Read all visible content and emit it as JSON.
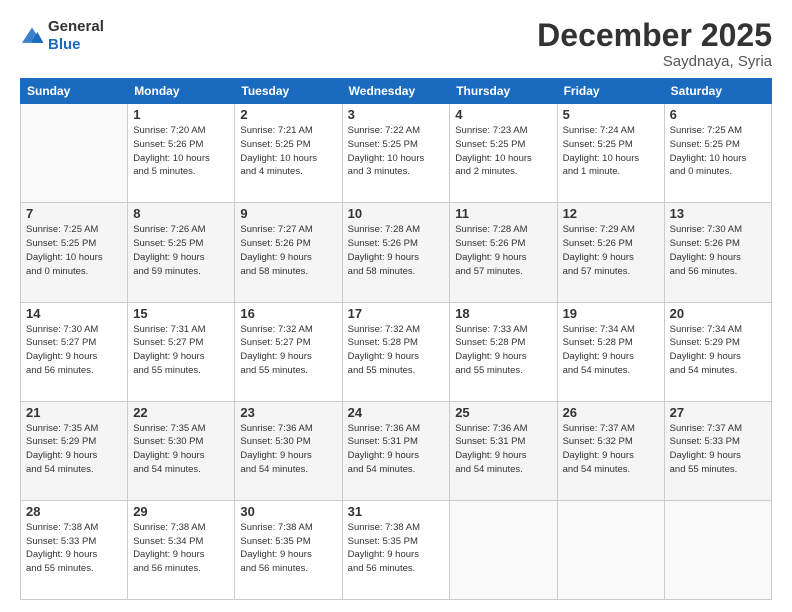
{
  "logo": {
    "general": "General",
    "blue": "Blue"
  },
  "header": {
    "month": "December 2025",
    "location": "Saydnaya, Syria"
  },
  "days_of_week": [
    "Sunday",
    "Monday",
    "Tuesday",
    "Wednesday",
    "Thursday",
    "Friday",
    "Saturday"
  ],
  "weeks": [
    [
      {
        "day": "",
        "info": ""
      },
      {
        "day": "1",
        "info": "Sunrise: 7:20 AM\nSunset: 5:26 PM\nDaylight: 10 hours\nand 5 minutes."
      },
      {
        "day": "2",
        "info": "Sunrise: 7:21 AM\nSunset: 5:25 PM\nDaylight: 10 hours\nand 4 minutes."
      },
      {
        "day": "3",
        "info": "Sunrise: 7:22 AM\nSunset: 5:25 PM\nDaylight: 10 hours\nand 3 minutes."
      },
      {
        "day": "4",
        "info": "Sunrise: 7:23 AM\nSunset: 5:25 PM\nDaylight: 10 hours\nand 2 minutes."
      },
      {
        "day": "5",
        "info": "Sunrise: 7:24 AM\nSunset: 5:25 PM\nDaylight: 10 hours\nand 1 minute."
      },
      {
        "day": "6",
        "info": "Sunrise: 7:25 AM\nSunset: 5:25 PM\nDaylight: 10 hours\nand 0 minutes."
      }
    ],
    [
      {
        "day": "7",
        "info": "Sunrise: 7:25 AM\nSunset: 5:25 PM\nDaylight: 10 hours\nand 0 minutes."
      },
      {
        "day": "8",
        "info": "Sunrise: 7:26 AM\nSunset: 5:25 PM\nDaylight: 9 hours\nand 59 minutes."
      },
      {
        "day": "9",
        "info": "Sunrise: 7:27 AM\nSunset: 5:26 PM\nDaylight: 9 hours\nand 58 minutes."
      },
      {
        "day": "10",
        "info": "Sunrise: 7:28 AM\nSunset: 5:26 PM\nDaylight: 9 hours\nand 58 minutes."
      },
      {
        "day": "11",
        "info": "Sunrise: 7:28 AM\nSunset: 5:26 PM\nDaylight: 9 hours\nand 57 minutes."
      },
      {
        "day": "12",
        "info": "Sunrise: 7:29 AM\nSunset: 5:26 PM\nDaylight: 9 hours\nand 57 minutes."
      },
      {
        "day": "13",
        "info": "Sunrise: 7:30 AM\nSunset: 5:26 PM\nDaylight: 9 hours\nand 56 minutes."
      }
    ],
    [
      {
        "day": "14",
        "info": "Sunrise: 7:30 AM\nSunset: 5:27 PM\nDaylight: 9 hours\nand 56 minutes."
      },
      {
        "day": "15",
        "info": "Sunrise: 7:31 AM\nSunset: 5:27 PM\nDaylight: 9 hours\nand 55 minutes."
      },
      {
        "day": "16",
        "info": "Sunrise: 7:32 AM\nSunset: 5:27 PM\nDaylight: 9 hours\nand 55 minutes."
      },
      {
        "day": "17",
        "info": "Sunrise: 7:32 AM\nSunset: 5:28 PM\nDaylight: 9 hours\nand 55 minutes."
      },
      {
        "day": "18",
        "info": "Sunrise: 7:33 AM\nSunset: 5:28 PM\nDaylight: 9 hours\nand 55 minutes."
      },
      {
        "day": "19",
        "info": "Sunrise: 7:34 AM\nSunset: 5:28 PM\nDaylight: 9 hours\nand 54 minutes."
      },
      {
        "day": "20",
        "info": "Sunrise: 7:34 AM\nSunset: 5:29 PM\nDaylight: 9 hours\nand 54 minutes."
      }
    ],
    [
      {
        "day": "21",
        "info": "Sunrise: 7:35 AM\nSunset: 5:29 PM\nDaylight: 9 hours\nand 54 minutes."
      },
      {
        "day": "22",
        "info": "Sunrise: 7:35 AM\nSunset: 5:30 PM\nDaylight: 9 hours\nand 54 minutes."
      },
      {
        "day": "23",
        "info": "Sunrise: 7:36 AM\nSunset: 5:30 PM\nDaylight: 9 hours\nand 54 minutes."
      },
      {
        "day": "24",
        "info": "Sunrise: 7:36 AM\nSunset: 5:31 PM\nDaylight: 9 hours\nand 54 minutes."
      },
      {
        "day": "25",
        "info": "Sunrise: 7:36 AM\nSunset: 5:31 PM\nDaylight: 9 hours\nand 54 minutes."
      },
      {
        "day": "26",
        "info": "Sunrise: 7:37 AM\nSunset: 5:32 PM\nDaylight: 9 hours\nand 54 minutes."
      },
      {
        "day": "27",
        "info": "Sunrise: 7:37 AM\nSunset: 5:33 PM\nDaylight: 9 hours\nand 55 minutes."
      }
    ],
    [
      {
        "day": "28",
        "info": "Sunrise: 7:38 AM\nSunset: 5:33 PM\nDaylight: 9 hours\nand 55 minutes."
      },
      {
        "day": "29",
        "info": "Sunrise: 7:38 AM\nSunset: 5:34 PM\nDaylight: 9 hours\nand 56 minutes."
      },
      {
        "day": "30",
        "info": "Sunrise: 7:38 AM\nSunset: 5:35 PM\nDaylight: 9 hours\nand 56 minutes."
      },
      {
        "day": "31",
        "info": "Sunrise: 7:38 AM\nSunset: 5:35 PM\nDaylight: 9 hours\nand 56 minutes."
      },
      {
        "day": "",
        "info": ""
      },
      {
        "day": "",
        "info": ""
      },
      {
        "day": "",
        "info": ""
      }
    ]
  ]
}
